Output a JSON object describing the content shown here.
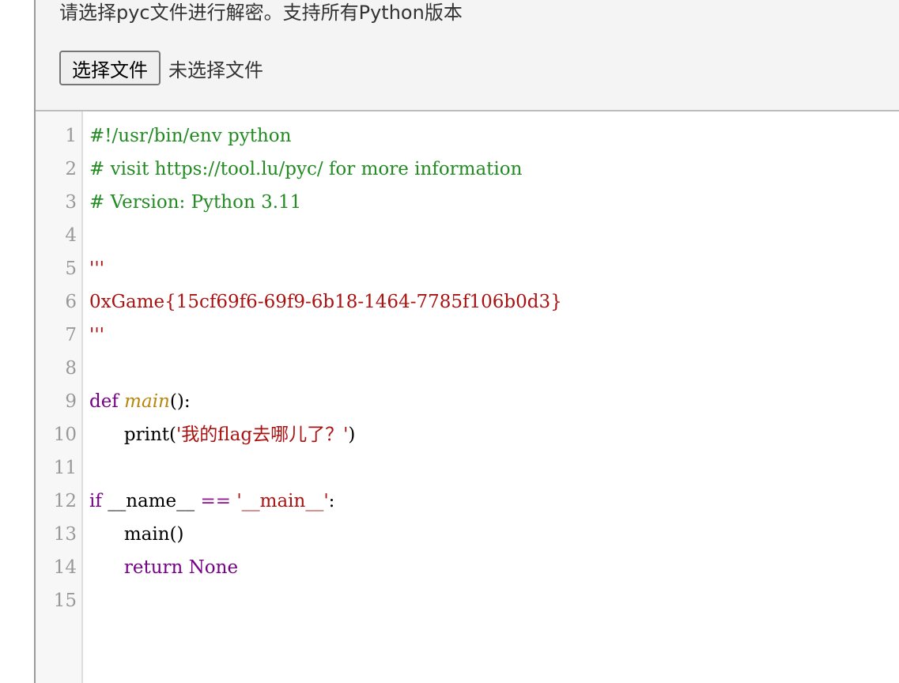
{
  "panel": {
    "instructions": "请选择pyc文件进行解密。支持所有Python版本",
    "file_button_label": "选择文件",
    "file_status": "未选择文件"
  },
  "editor": {
    "line_numbers": [
      "1",
      "2",
      "3",
      "4",
      "5",
      "6",
      "7",
      "8",
      "9",
      "10",
      "11",
      "12",
      "13",
      "14",
      "15"
    ],
    "lines": [
      {
        "tokens": [
          {
            "t": "#!/usr/bin/env python",
            "c": "c-comment"
          }
        ]
      },
      {
        "tokens": [
          {
            "t": "# visit https://tool.lu/pyc/ for more information",
            "c": "c-comment"
          }
        ]
      },
      {
        "tokens": [
          {
            "t": "# Version: Python 3.11",
            "c": "c-comment"
          }
        ]
      },
      {
        "tokens": []
      },
      {
        "tokens": [
          {
            "t": "'''",
            "c": "c-string"
          }
        ]
      },
      {
        "tokens": [
          {
            "t": "0xGame{15cf69f6-69f9-6b18-1464-7785f106b0d3}",
            "c": "c-string"
          }
        ]
      },
      {
        "tokens": [
          {
            "t": "'''",
            "c": "c-string"
          }
        ]
      },
      {
        "tokens": []
      },
      {
        "tokens": [
          {
            "t": "def ",
            "c": "c-keyword"
          },
          {
            "t": "main",
            "c": "c-def"
          },
          {
            "t": "():",
            "c": "c-plain"
          }
        ]
      },
      {
        "tokens": [
          {
            "t": "      print(",
            "c": "c-plain"
          },
          {
            "t": "'我的flag去哪儿了？'",
            "c": "c-string"
          },
          {
            "t": ")",
            "c": "c-plain"
          }
        ]
      },
      {
        "tokens": []
      },
      {
        "tokens": [
          {
            "t": "if ",
            "c": "c-keyword"
          },
          {
            "t": "__name__ ",
            "c": "c-plain"
          },
          {
            "t": "== ",
            "c": "c-op"
          },
          {
            "t": "'__main__'",
            "c": "c-string"
          },
          {
            "t": ":",
            "c": "c-plain"
          }
        ]
      },
      {
        "tokens": [
          {
            "t": "      main()",
            "c": "c-plain"
          }
        ]
      },
      {
        "tokens": [
          {
            "t": "      ",
            "c": "c-plain"
          },
          {
            "t": "return None",
            "c": "c-keyword"
          }
        ]
      },
      {
        "tokens": []
      }
    ]
  }
}
